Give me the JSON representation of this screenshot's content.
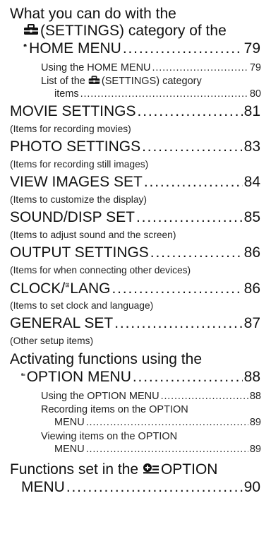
{
  "toc": {
    "settings_category": {
      "line1": "What you can do with the",
      "line2_text": "(SETTINGS) category of the",
      "line3_text": "HOME MENU",
      "line3_page": "79",
      "sub1_text": "Using the HOME MENU",
      "sub1_page": "79",
      "sub2_text": "(SETTINGS) category",
      "sub2_prefix": "List of the",
      "sub2_cont": "items",
      "sub2_page": "80"
    },
    "movie": {
      "title": "MOVIE SETTINGS",
      "page": "81",
      "desc": "(Items for recording movies)"
    },
    "photo": {
      "title": "PHOTO SETTINGS",
      "page": "83",
      "desc": "(Items for recording still images)"
    },
    "view": {
      "title": "VIEW IMAGES SET",
      "page": "84",
      "desc": "(Items to customize the display)"
    },
    "sound": {
      "title": "SOUND/DISP SET",
      "page": "85",
      "desc": "(Items to adjust sound and the screen)"
    },
    "output": {
      "title": "OUTPUT SETTINGS",
      "page": "86",
      "desc": "(Items for when connecting other devices)"
    },
    "clock": {
      "title_pre": "CLOCK/",
      "title_post": "LANG",
      "page": "86",
      "desc": "(Items to set clock and language)"
    },
    "general": {
      "title": "GENERAL SET",
      "page": "87",
      "desc": "(Other setup items)"
    },
    "option": {
      "line1": "Activating functions using the",
      "line2_text": "OPTION MENU",
      "line2_page": "88",
      "sub1_text": "Using the OPTION MENU",
      "sub1_page": "88",
      "sub2_line1": "Recording items on the OPTION",
      "sub2_line2": "MENU",
      "sub2_page": "89",
      "sub3_line1": "Viewing items on the OPTION",
      "sub3_line2": "MENU",
      "sub3_page": "89"
    },
    "functions": {
      "line1_text": "Functions set in the",
      "line1_icon_text": "OPTION",
      "line2_text": "MENU",
      "line2_page": "90"
    }
  },
  "icons": {
    "settings": "toolbox-icon",
    "home": "house-icon",
    "option": "option-icon",
    "lang": "language-A-icon"
  }
}
